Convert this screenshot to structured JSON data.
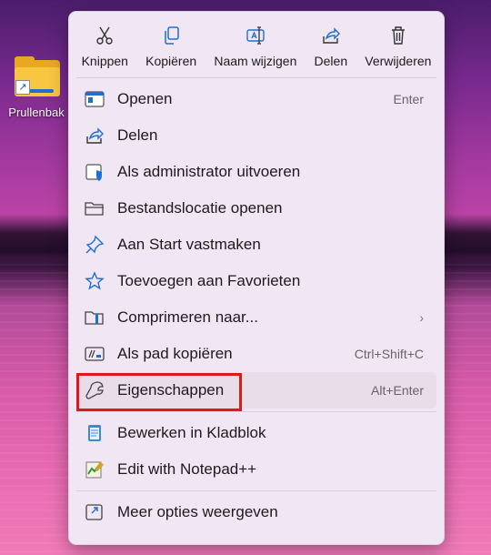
{
  "desktop": {
    "icon_label": "Prullenbak"
  },
  "toolbar": {
    "cut_label": "Knippen",
    "copy_label": "Kopiëren",
    "rename_label": "Naam wijzigen",
    "share_label": "Delen",
    "delete_label": "Verwijderen"
  },
  "menu": {
    "items": [
      {
        "label": "Openen",
        "shortcut": "Enter"
      },
      {
        "label": "Delen",
        "shortcut": ""
      },
      {
        "label": "Als administrator uitvoeren",
        "shortcut": ""
      },
      {
        "label": "Bestandslocatie openen",
        "shortcut": ""
      },
      {
        "label": "Aan Start vastmaken",
        "shortcut": ""
      },
      {
        "label": "Toevoegen aan Favorieten",
        "shortcut": ""
      },
      {
        "label": "Comprimeren naar...",
        "shortcut": ""
      },
      {
        "label": "Als pad kopiëren",
        "shortcut": "Ctrl+Shift+C"
      },
      {
        "label": "Eigenschappen",
        "shortcut": "Alt+Enter"
      }
    ],
    "extra_items": [
      {
        "label": "Bewerken in Kladblok"
      },
      {
        "label": "Edit with Notepad++"
      }
    ],
    "more_options_label": "Meer opties weergeven"
  },
  "colors": {
    "accent": "#1f6fd0",
    "highlight_border": "#e01818",
    "menu_bg": "#f1e6f3"
  }
}
